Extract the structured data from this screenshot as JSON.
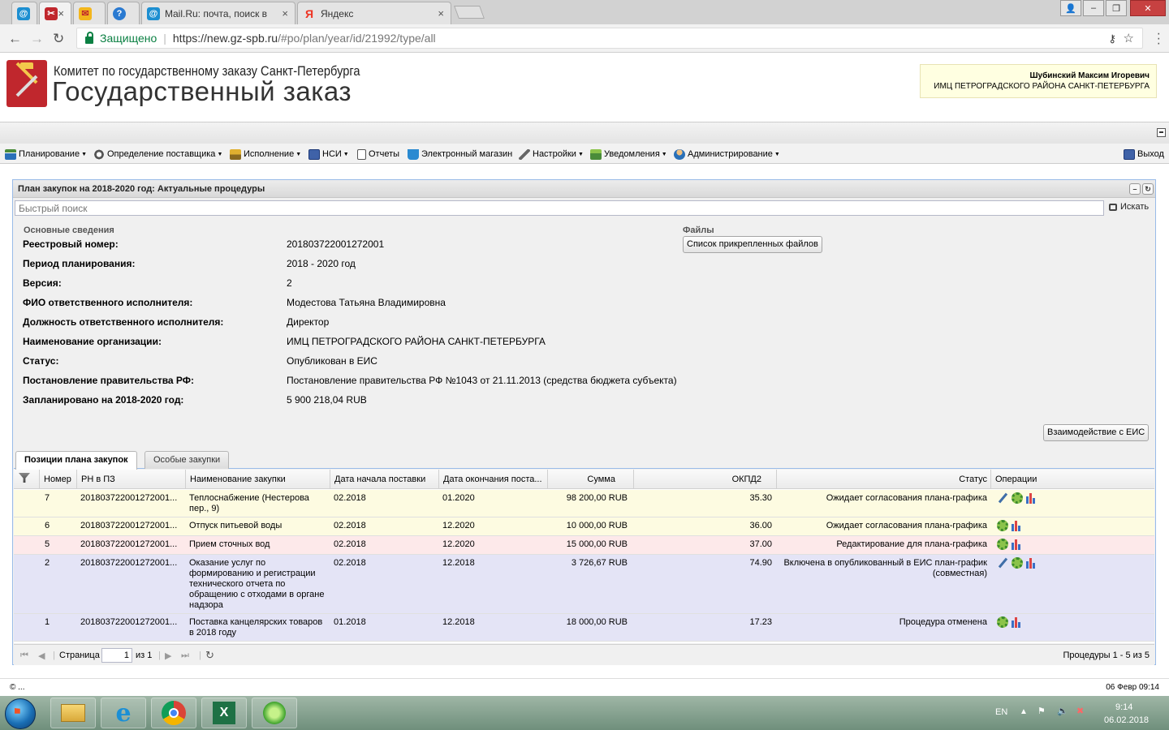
{
  "browser": {
    "tabs": [
      {
        "title": "",
        "favicon": "mail-at-icon",
        "active": false
      },
      {
        "title": "",
        "favicon": "tools-icon",
        "active": true
      },
      {
        "title": "",
        "favicon": "envelope-icon",
        "active": false
      },
      {
        "title": "",
        "favicon": "info-icon",
        "active": false
      },
      {
        "title": "Mail.Ru: почта, поиск в",
        "favicon": "mail-at-icon",
        "active": false
      },
      {
        "title": "Яндекс",
        "favicon": "yandex-icon",
        "active": false
      }
    ],
    "secure_label": "Защищено",
    "url_host": "https://new.gz-spb.ru",
    "url_path": "/#po/plan/year/id/21992/type/all"
  },
  "site": {
    "org_line": "Комитет по государственному заказу Санкт-Петербурга",
    "title": "Государственный заказ",
    "user_name": "Шубинский Максим Игоревич",
    "user_org": "ИМЦ ПЕТРОГРАДСКОГО РАЙОНА САНКТ-ПЕТЕРБУРГА"
  },
  "menu": {
    "items": [
      {
        "label": "Планирование",
        "icon": "planning-icon",
        "dropdown": true
      },
      {
        "label": "Определение поставщика",
        "icon": "supplier-icon",
        "dropdown": true
      },
      {
        "label": "Исполнение",
        "icon": "execution-icon",
        "dropdown": true
      },
      {
        "label": "НСИ",
        "icon": "book-icon",
        "dropdown": true
      },
      {
        "label": "Отчеты",
        "icon": "report-icon",
        "dropdown": false
      },
      {
        "label": "Электронный магазин",
        "icon": "cart-icon",
        "dropdown": false
      },
      {
        "label": "Настройки",
        "icon": "wrench-icon",
        "dropdown": true
      },
      {
        "label": "Уведомления",
        "icon": "notification-icon",
        "dropdown": true
      },
      {
        "label": "Администрирование",
        "icon": "admin-user-icon",
        "dropdown": true
      }
    ],
    "exit_label": "Выход"
  },
  "panel": {
    "title": "План закупок на 2018-2020 год: Актуальные процедуры",
    "search_placeholder": "Быстрый поиск",
    "search_button": "Искать",
    "main_section": "Основные сведения",
    "files_section": "Файлы",
    "files_button": "Список прикрепленных файлов",
    "eis_button": "Взаимодействие с ЕИС",
    "fields": [
      {
        "label": "Реестровый номер:",
        "value": "201803722001272001"
      },
      {
        "label": "Период планирования:",
        "value": "2018 - 2020 год"
      },
      {
        "label": "Версия:",
        "value": "2"
      },
      {
        "label": "ФИО ответственного исполнителя:",
        "value": "Модестова Татьяна Владимировна"
      },
      {
        "label": "Должность ответственного исполнителя:",
        "value": "Директор"
      },
      {
        "label": "Наименование организации:",
        "value": "ИМЦ ПЕТРОГРАДСКОГО РАЙОНА САНКТ-ПЕТЕРБУРГА"
      },
      {
        "label": "Статус:",
        "value": "Опубликован в ЕИС"
      },
      {
        "label": "Постановление правительства РФ:",
        "value": "Постановление правительства РФ №1043 от 21.11.2013 (средства бюджета субъекта)"
      },
      {
        "label": "Запланировано на 2018-2020 год:",
        "value": "5 900 218,04 RUB"
      }
    ]
  },
  "tabs": {
    "active": "Позиции плана закупок",
    "other": "Особые закупки"
  },
  "grid": {
    "columns": [
      "",
      "Номер",
      "РН в ПЗ",
      "Наименование закупки",
      "Дата начала поставки",
      "Дата окончания поста...",
      "Сумма",
      "ОКПД2",
      "Статус",
      "Операции"
    ],
    "rows": [
      {
        "num": "7",
        "rn": "201803722001272001...",
        "name": "Теплоснабжение (Нестерова пер., 9)",
        "start": "02.2018",
        "end": "01.2020",
        "sum": "98 200,00 RUB",
        "okpd": "35.30",
        "status": "Ожидает согласования плана-графика",
        "color": "#fdfbe1",
        "ops": [
          "edit",
          "gear",
          "chart"
        ]
      },
      {
        "num": "6",
        "rn": "201803722001272001...",
        "name": "Отпуск питьевой воды",
        "start": "02.2018",
        "end": "12.2020",
        "sum": "10 000,00 RUB",
        "okpd": "36.00",
        "status": "Ожидает согласования плана-графика",
        "color": "#fdfbe1",
        "ops": [
          "gear",
          "chart"
        ]
      },
      {
        "num": "5",
        "rn": "201803722001272001...",
        "name": "Прием сточных вод",
        "start": "02.2018",
        "end": "12.2020",
        "sum": "15 000,00 RUB",
        "okpd": "37.00",
        "status": "Редактирование для плана-графика",
        "color": "#fde9ea",
        "ops": [
          "gear",
          "chart"
        ]
      },
      {
        "num": "2",
        "rn": "201803722001272001...",
        "name": "Оказание услуг по формированию и регистрации технического отчета по обращению с отходами в органе надзора",
        "start": "02.2018",
        "end": "12.2018",
        "sum": "3 726,67 RUB",
        "okpd": "74.90",
        "status": "Включена в опубликованный в ЕИС план-график (совместная)",
        "color": "#e4e4f6",
        "ops": [
          "edit",
          "gear",
          "chart"
        ]
      },
      {
        "num": "1",
        "rn": "201803722001272001...",
        "name": "Поставка канцелярских товаров в 2018 году",
        "start": "01.2018",
        "end": "12.2018",
        "sum": "18 000,00 RUB",
        "okpd": "17.23",
        "status": "Процедура отменена",
        "color": "#e4e4f6",
        "ops": [
          "gear",
          "chart"
        ]
      }
    ]
  },
  "pager": {
    "page_label": "Страница",
    "page_value": "1",
    "of_label": "из 1",
    "summary": "Процедуры 1 - 5 из 5"
  },
  "status": {
    "left": "© ...",
    "right": "06 Февр 09:14"
  },
  "taskbar": {
    "apps": [
      "explorer-icon",
      "ie-icon",
      "chrome-icon",
      "excel-icon",
      "app-icon"
    ],
    "lang": "EN",
    "time": "9:14",
    "date": "06.02.2018"
  },
  "colors": {
    "panel_border": "#99bbe8",
    "row_yellow": "#fdfbe1",
    "row_pink": "#fde9ea",
    "row_lavender": "#e4e4f6",
    "secure_green": "#0b8043"
  }
}
